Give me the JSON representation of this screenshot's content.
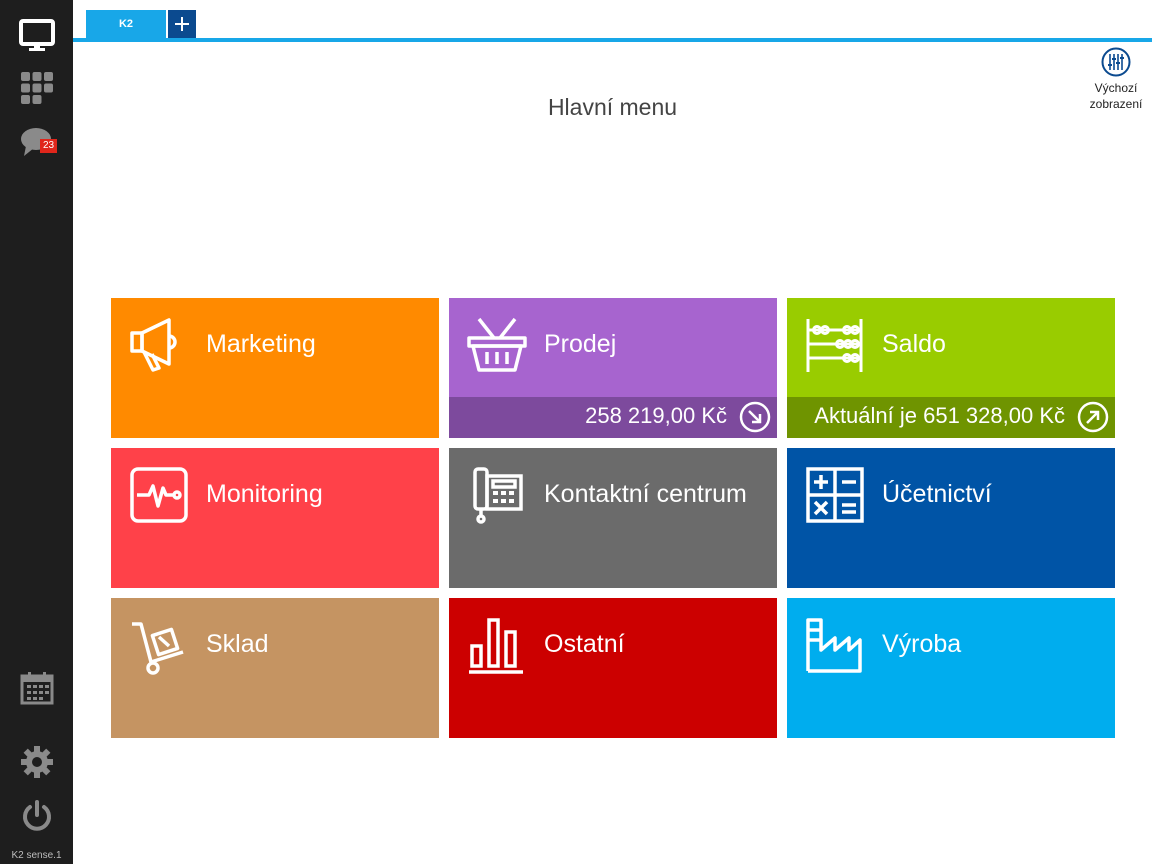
{
  "app": {
    "name": "K2 sense.1"
  },
  "sidebar": {
    "messages_badge": "23",
    "footer": "K2 sense.1"
  },
  "tabs": {
    "active_label": "K2",
    "add_symbol": "+"
  },
  "header": {
    "title": "Hlavní menu",
    "view_button_line1": "Výchozí",
    "view_button_line2": "zobrazení"
  },
  "colors": {
    "accent": "#18a7e8",
    "sidebar": "#1e1e1e"
  },
  "tiles": [
    {
      "label": "Marketing",
      "color": "#ff8a00",
      "icon": "megaphone-icon"
    },
    {
      "label": "Prodej",
      "color": "#a764cf",
      "icon": "basket-icon",
      "footer": "258 219,00 Kč",
      "footer_color": "#7d4a9d",
      "footer_arrow": "down-right"
    },
    {
      "label": "Saldo",
      "color": "#99cc00",
      "icon": "abacus-icon",
      "footer": "Aktuální je 651 328,00 Kč",
      "footer_color": "#6f9400",
      "footer_arrow": "up-right"
    },
    {
      "label": "Monitoring",
      "color": "#ff4149",
      "icon": "heartbeat-monitor-icon"
    },
    {
      "label": "Kontaktní centrum",
      "color": "#6b6b6b",
      "icon": "telephone-icon"
    },
    {
      "label": "Účetnictví",
      "color": "#0054a6",
      "icon": "calculator-icon"
    },
    {
      "label": "Sklad",
      "color": "#c59462",
      "icon": "hand-truck-icon"
    },
    {
      "label": "Ostatní",
      "color": "#cc0000",
      "icon": "bar-chart-icon"
    },
    {
      "label": "Výroba",
      "color": "#00adee",
      "icon": "factory-icon"
    }
  ]
}
